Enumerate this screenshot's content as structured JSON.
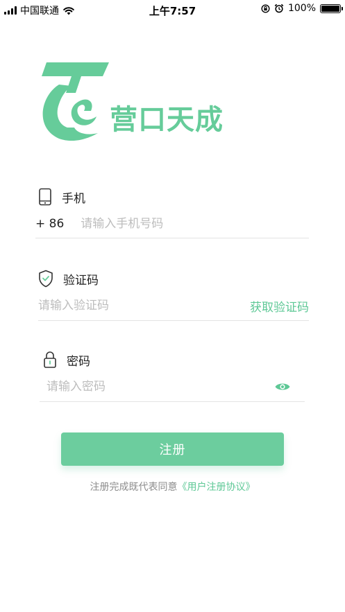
{
  "status_bar": {
    "carrier": "中国联通",
    "time": "上午7:57",
    "battery": "100%",
    "battery_level": 1.0,
    "icons": [
      "signal-icon",
      "wifi-icon",
      "rotation-lock-icon",
      "alarm-icon",
      "battery-icon"
    ]
  },
  "brand": {
    "name": "营口天成",
    "color": "#66cc9a"
  },
  "phone": {
    "label": "手机",
    "prefix": "+ 86",
    "placeholder": "请输入手机号码",
    "value": ""
  },
  "code": {
    "label": "验证码",
    "placeholder": "请输入验证码",
    "value": "",
    "get_code_label": "获取验证码"
  },
  "password": {
    "label": "密码",
    "placeholder": "请输入密码",
    "value": ""
  },
  "register": {
    "label": "注册"
  },
  "agreement": {
    "text": "注册完成既代表同意",
    "link": "《用户注册协议》"
  },
  "colors": {
    "accent": "#66cc9a",
    "divider": "#e3e3e3",
    "placeholder": "#bdbdbd"
  }
}
